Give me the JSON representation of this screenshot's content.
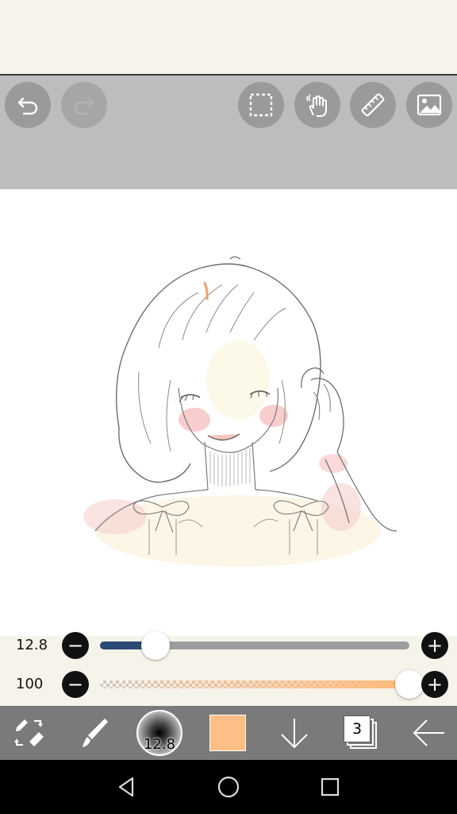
{
  "colors": {
    "toolbar_bg": "#bdbdbd",
    "button_bg": "#9a9a9a",
    "size_fill": "#2b4a75",
    "opacity_fill": "#ffb97a",
    "current_color": "#ffbe85",
    "bottom_bar": "#7a7a7a"
  },
  "toolbar": {
    "icons": [
      "undo-icon",
      "redo-icon",
      "selection-icon",
      "hand-icon",
      "ruler-icon",
      "image-icon"
    ]
  },
  "sliders": {
    "brush_size": {
      "value_label": "12.8",
      "fraction": 0.18
    },
    "opacity": {
      "value_label": "100",
      "fraction": 1.0
    }
  },
  "bottom_bar": {
    "brush_preview_label": "12.8",
    "layer_count": "3"
  }
}
